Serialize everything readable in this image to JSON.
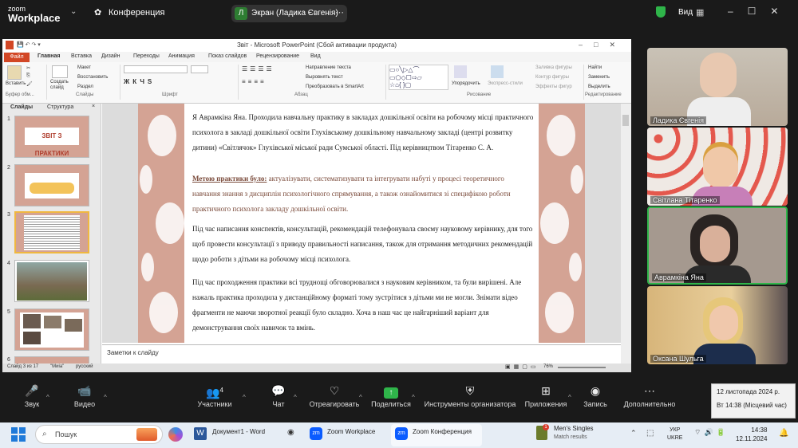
{
  "zoom": {
    "brand_line1": "zoom",
    "brand_line2": "Workplace",
    "meeting_title": "Конференция",
    "share_pill": {
      "avatar": "Л",
      "label": "Экран (Ладика Євгенія)"
    },
    "view_label": "Вид"
  },
  "ppt": {
    "window_title": "Звіт - Microsoft PowerPoint (Сбой активации продукта)",
    "file_tab": "Файл",
    "tabs": [
      "Главная",
      "Вставка",
      "Дизайн",
      "Переходы",
      "Анимация",
      "Показ слайдов",
      "Рецензирование",
      "Вид"
    ],
    "ribbon": {
      "paste": "Вставить",
      "cut": "Вырезать",
      "copy": "Копировать",
      "format": "Формат по образцу",
      "create_slide": "Создать слайд",
      "layout": "Макет",
      "reset": "Восстановить",
      "section": "Раздел",
      "groups": [
        "Буфер обм...",
        "Слайды",
        "Шрифт",
        "Абзац",
        "Рисование",
        "Редактирование"
      ],
      "text_dir": "Направление текста",
      "align_text": "Выровнять текст",
      "smartart": "Преобразовать в SmartArt",
      "arrange": "Упорядочить",
      "quick_styles": "Экспресс-стили",
      "fill": "Заливка фигуры",
      "outline": "Контур фигуры",
      "effects": "Эффекты фигур",
      "find": "Найти",
      "replace": "Заменить",
      "select": "Выделить"
    },
    "pane_tabs": [
      "Слайды",
      "Структура"
    ],
    "thumbs": [
      {
        "num": "1",
        "title": "ЗВІТ З ПРАКТИКИ"
      },
      {
        "num": "2",
        "title": ""
      },
      {
        "num": "3",
        "title": ""
      },
      {
        "num": "4",
        "title": ""
      },
      {
        "num": "5",
        "title": ""
      },
      {
        "num": "6",
        "title": ""
      }
    ],
    "slide_paragraphs": [
      "Я Аврамкіна Яна. Проходила навчальну практику в закладах дошкільної освіти на робочому місці практичного психолога в закладі дошкільної освіти Глухівському дошкільному навчальному закладі (центрі розвитку дитини) «Світлячок» Глухівської міської ради Сумської області. Під керівництвом Тітаренко С. А.",
      "актуалізувати, систематизувати та інтегрувати набуті у процесі теоретичного навчання знання з дисциплін психологічного спрямування, а також ознайомитися зі специфікою роботи практичного психолога закладу дошкільної освіти.",
      "Під час написання конспектів, консультацій, рекомендацій телефонувала своєму науковому керівнику, для того щоб провести консультації з приводу правильності написання, також для отримання методичних рекомендацій щодо роботи з дітьми на робочому місці психолога.",
      "Під час проходження практики всі труднощі обговорювалися з науковим керівником, та були вирішені. Але нажаль практика проходила у дистанційному форматі тому зустрітися з дітьми ми не могли. Знімати відео фрагменти не маючи зворотної реакції було складно. Хоча в наш час це найгарніший варіант для демонстрування своїх навичок та вмінь."
    ],
    "goal_label": "Метою практики було:",
    "notes_placeholder": "Заметки к слайду",
    "status": {
      "slide": "Слайд 3 из 17",
      "theme": "\"Миіа\"",
      "lang": "русский",
      "zoom": "76%"
    }
  },
  "participants": [
    {
      "name": "Ладика Євгенія"
    },
    {
      "name": "Світлана Тітаренко"
    },
    {
      "name": "Аврамкіна Яна"
    },
    {
      "name": "Оксана Шульга"
    }
  ],
  "toolbar": [
    {
      "label": "Звук",
      "icon": "mic-icon"
    },
    {
      "label": "Видео",
      "icon": "camera-icon"
    },
    {
      "label": "Участники",
      "icon": "participants-icon",
      "count": "4"
    },
    {
      "label": "Чат",
      "icon": "chat-icon"
    },
    {
      "label": "Отреагировать",
      "icon": "heart-icon"
    },
    {
      "label": "Поделиться",
      "icon": "share-icon"
    },
    {
      "label": "Инструменты организатора",
      "icon": "shield-icon"
    },
    {
      "label": "Приложения",
      "icon": "apps-icon"
    },
    {
      "label": "Запись",
      "icon": "record-icon"
    },
    {
      "label": "Дополнительно",
      "icon": "more-icon"
    }
  ],
  "clock_popup": {
    "date": "12 листопада 2024 р.",
    "time": "Вт 14:38 (Місцевий час)"
  },
  "taskbar": {
    "search_placeholder": "Пошук",
    "apps": [
      "Документ1 - Word",
      "Zoom Workplace",
      "Zoom Конференция"
    ],
    "notif_title": "Men's Singles",
    "notif_sub": "Match results",
    "lang1": "УКР",
    "lang2": "UKRE",
    "time": "14:38",
    "date": "12.11.2024"
  },
  "colors": {
    "zoom_bg": "#1a1a1a",
    "share_green": "#2fb54a",
    "ppt_orange": "#d24726",
    "slide_border": "#d4a394",
    "active_tile": "#2fb54a"
  }
}
